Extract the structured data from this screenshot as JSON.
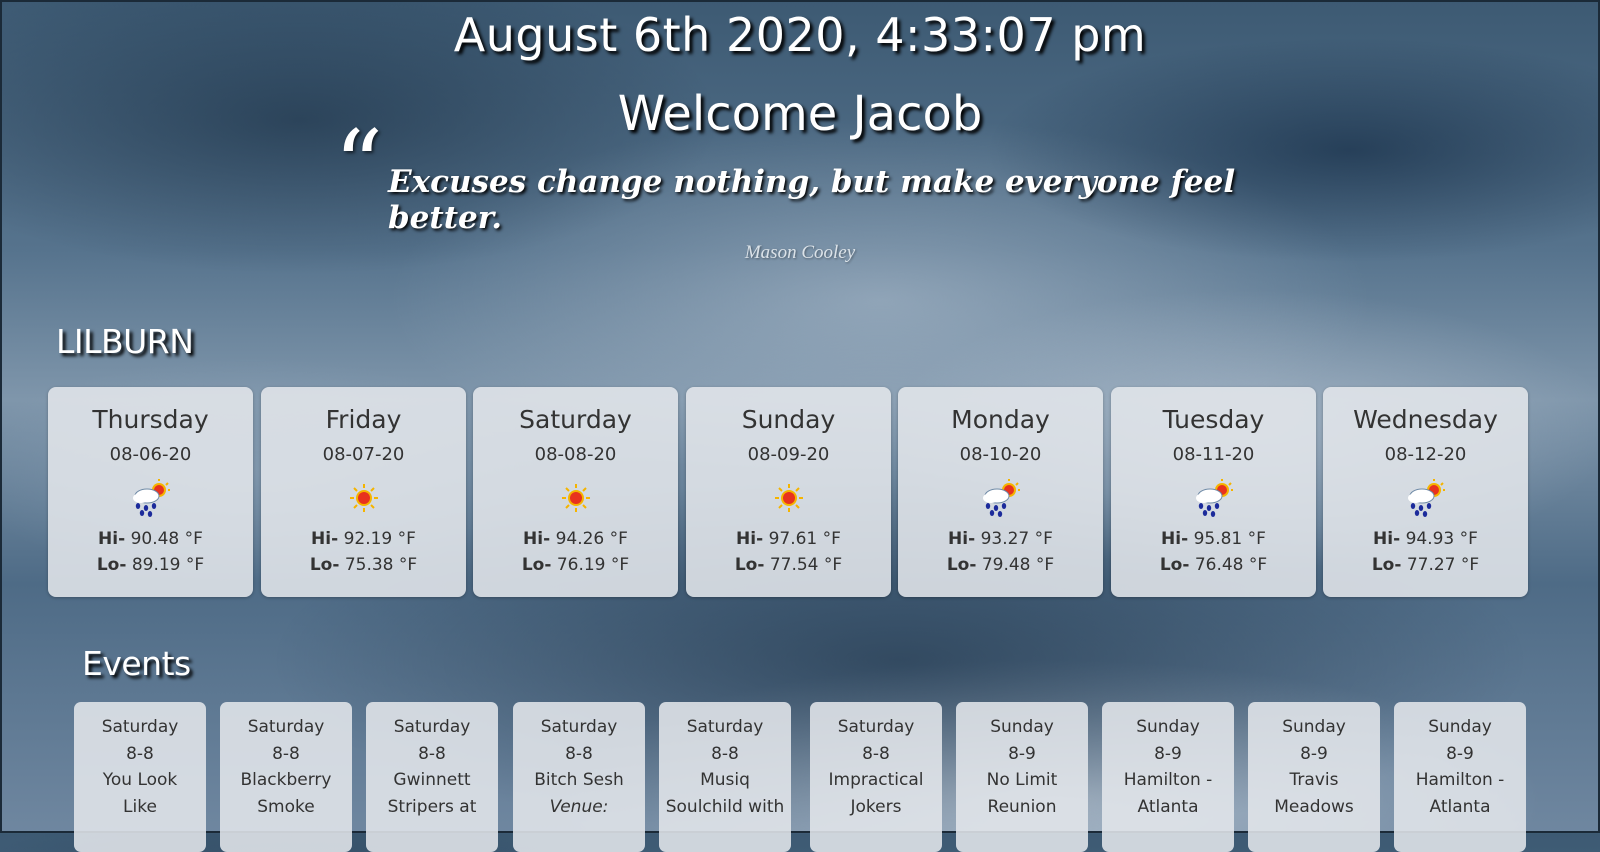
{
  "header": {
    "datetime": "August 6th 2020, 4:33:07 pm",
    "welcome": "Welcome Jacob"
  },
  "quote": {
    "mark": "“",
    "text": "Excuses change nothing, but make everyone feel better.",
    "author": "Mason Cooley"
  },
  "weather": {
    "city": "LILBURN",
    "days": [
      {
        "day": "Thursday",
        "date": "08-06-20",
        "icon": "rain-sun-icon",
        "hi_label": "Hi-",
        "hi": "90.48 °F",
        "lo_label": "Lo-",
        "lo": "89.19 °F"
      },
      {
        "day": "Friday",
        "date": "08-07-20",
        "icon": "sun-icon",
        "hi_label": "Hi-",
        "hi": "92.19 °F",
        "lo_label": "Lo-",
        "lo": "75.38 °F"
      },
      {
        "day": "Saturday",
        "date": "08-08-20",
        "icon": "sun-icon",
        "hi_label": "Hi-",
        "hi": "94.26 °F",
        "lo_label": "Lo-",
        "lo": "76.19 °F"
      },
      {
        "day": "Sunday",
        "date": "08-09-20",
        "icon": "sun-icon",
        "hi_label": "Hi-",
        "hi": "97.61 °F",
        "lo_label": "Lo-",
        "lo": "77.54 °F"
      },
      {
        "day": "Monday",
        "date": "08-10-20",
        "icon": "rain-sun-icon",
        "hi_label": "Hi-",
        "hi": "93.27 °F",
        "lo_label": "Lo-",
        "lo": "79.48 °F"
      },
      {
        "day": "Tuesday",
        "date": "08-11-20",
        "icon": "rain-sun-icon",
        "hi_label": "Hi-",
        "hi": "95.81 °F",
        "lo_label": "Lo-",
        "lo": "76.48 °F"
      },
      {
        "day": "Wednesday",
        "date": "08-12-20",
        "icon": "rain-sun-icon",
        "hi_label": "Hi-",
        "hi": "94.93 °F",
        "lo_label": "Lo-",
        "lo": "77.27 °F"
      }
    ]
  },
  "events": {
    "title": "Events",
    "items": [
      {
        "day": "Saturday",
        "date": "8-8",
        "name1": "You Look",
        "name2": "Like"
      },
      {
        "day": "Saturday",
        "date": "8-8",
        "name1": "Blackberry",
        "name2": "Smoke"
      },
      {
        "day": "Saturday",
        "date": "8-8",
        "name1": "Gwinnett",
        "name2": "Stripers at"
      },
      {
        "day": "Saturday",
        "date": "8-8",
        "name1": "Bitch Sesh",
        "name2": "Venue:"
      },
      {
        "day": "Saturday",
        "date": "8-8",
        "name1": "Musiq",
        "name2": "Soulchild with"
      },
      {
        "day": "Saturday",
        "date": "8-8",
        "name1": "Impractical",
        "name2": "Jokers"
      },
      {
        "day": "Sunday",
        "date": "8-9",
        "name1": "No Limit",
        "name2": "Reunion"
      },
      {
        "day": "Sunday",
        "date": "8-9",
        "name1": "Hamilton -",
        "name2": "Atlanta"
      },
      {
        "day": "Sunday",
        "date": "8-9",
        "name1": "Travis",
        "name2": "Meadows"
      },
      {
        "day": "Sunday",
        "date": "8-9",
        "name1": "Hamilton -",
        "name2": "Atlanta"
      }
    ]
  },
  "colors": {
    "card_bg": "#e2e6eb",
    "text_dark": "#333333",
    "heading_white": "#ffffff"
  }
}
